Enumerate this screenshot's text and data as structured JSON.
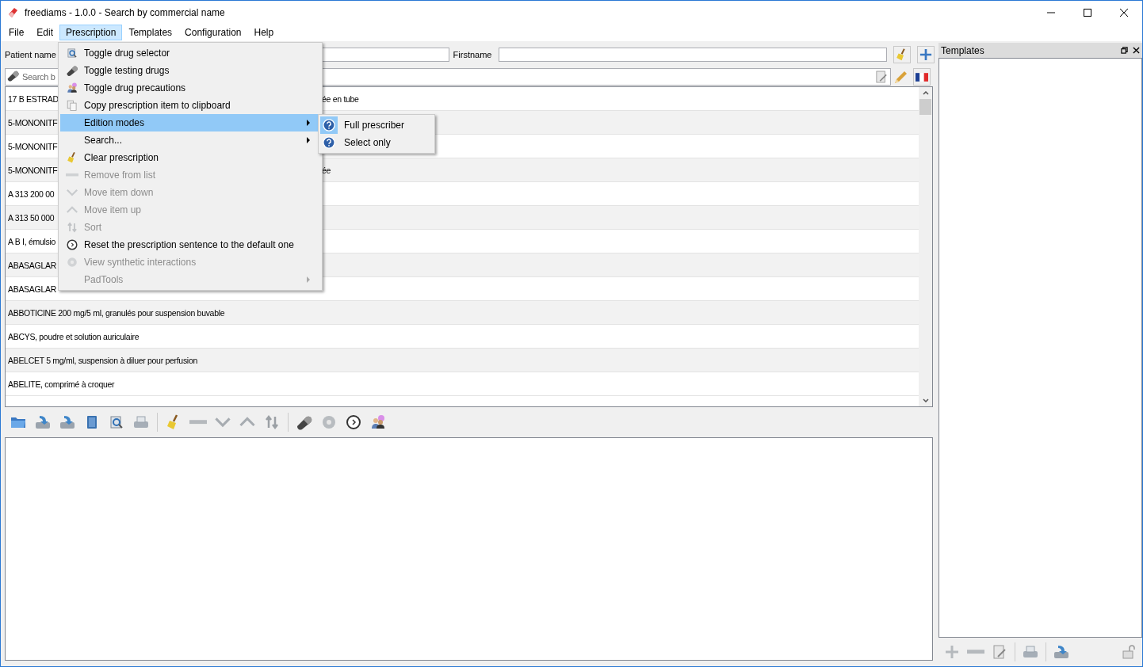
{
  "window": {
    "title": "freediams - 1.0.0 - Search by commercial name"
  },
  "menubar": [
    {
      "label": "File",
      "selected": false
    },
    {
      "label": "Edit",
      "selected": false
    },
    {
      "label": "Prescription",
      "selected": true
    },
    {
      "label": "Templates",
      "selected": false
    },
    {
      "label": "Configuration",
      "selected": false
    },
    {
      "label": "Help",
      "selected": false
    }
  ],
  "patient": {
    "name_label": "Patient name",
    "firstname_label": "Firstname"
  },
  "search": {
    "placeholder": "Search b"
  },
  "drugs": [
    {
      "text": "17 B ESTRAD",
      "text_after_menu": "ée en tube"
    },
    {
      "text": "5-MONONITF"
    },
    {
      "text": "5-MONONITF"
    },
    {
      "text": "5-MONONITF",
      "text_after_menu": "ée"
    },
    {
      "text": "A 313 200 00"
    },
    {
      "text": "A 313 50 000"
    },
    {
      "text": "A B I, émulsio"
    },
    {
      "text": "ABASAGLAR"
    },
    {
      "text": "ABASAGLAR"
    },
    {
      "text": "ABBOTICINE 200 mg/5 ml, granulés pour suspension buvable"
    },
    {
      "text": "ABCYS, poudre et solution auriculaire"
    },
    {
      "text": "ABELCET 5 mg/ml, suspension à diluer pour perfusion"
    },
    {
      "text": "ABELITE, comprimé à croquer"
    }
  ],
  "prescription_menu": [
    {
      "label": "Toggle drug selector",
      "kind": "action",
      "disabled": false,
      "selected": false
    },
    {
      "label": "Toggle testing drugs",
      "kind": "action",
      "disabled": false,
      "selected": false
    },
    {
      "label": "Toggle drug precautions",
      "kind": "action",
      "disabled": false,
      "selected": false
    },
    {
      "label": "Copy prescription item to clipboard",
      "kind": "action",
      "disabled": false,
      "selected": false
    },
    {
      "label": "Edition modes",
      "kind": "submenu",
      "disabled": false,
      "selected": true
    },
    {
      "label": "Search...",
      "kind": "submenu",
      "disabled": false,
      "selected": false
    },
    {
      "label": "Clear prescription",
      "kind": "action",
      "disabled": false,
      "selected": false
    },
    {
      "label": "Remove from list",
      "kind": "action",
      "disabled": true,
      "selected": false
    },
    {
      "label": "Move item down",
      "kind": "action",
      "disabled": true,
      "selected": false
    },
    {
      "label": "Move item up",
      "kind": "action",
      "disabled": true,
      "selected": false
    },
    {
      "label": "Sort",
      "kind": "action",
      "disabled": true,
      "selected": false
    },
    {
      "label": "Reset the prescription sentence to the default one",
      "kind": "action",
      "disabled": false,
      "selected": false
    },
    {
      "label": "View synthetic interactions",
      "kind": "action",
      "disabled": true,
      "selected": false
    },
    {
      "label": "PadTools",
      "kind": "submenu",
      "disabled": true,
      "selected": false
    }
  ],
  "edition_modes_submenu": [
    {
      "label": "Full prescriber",
      "selected": true
    },
    {
      "label": "Select only",
      "selected": false
    }
  ],
  "templates_dock": {
    "title": "Templates"
  }
}
